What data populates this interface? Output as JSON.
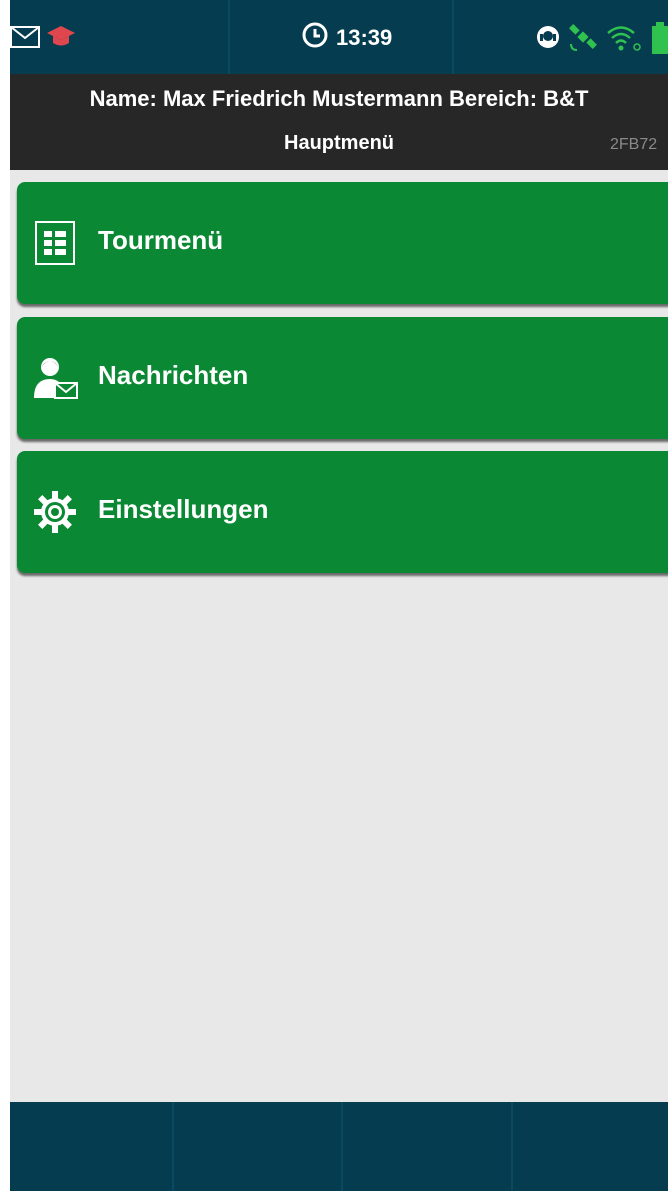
{
  "status_bar": {
    "time": "13:39",
    "icons_left": [
      "mail-icon",
      "graduation-cap-icon"
    ],
    "icons_right": [
      "headset-icon",
      "gps-satellite-icon",
      "wifi-icon",
      "battery-icon"
    ],
    "colors": {
      "background": "#053c4f",
      "cap": "#e0464d",
      "green": "#2fc24f"
    }
  },
  "header": {
    "name_line": "Name: Max Friedrich Mustermann Bereich: B&T",
    "title": "Hauptmenü",
    "code": "2FB72"
  },
  "menu": {
    "items": [
      {
        "label": "Tourmenü",
        "icon": "list-icon"
      },
      {
        "label": "Nachrichten",
        "icon": "user-message-icon"
      },
      {
        "label": "Einstellungen",
        "icon": "gear-icon"
      }
    ],
    "button_color": "#0b8833"
  },
  "bottom_bar": {
    "segments": 4,
    "color": "#053c4f"
  }
}
